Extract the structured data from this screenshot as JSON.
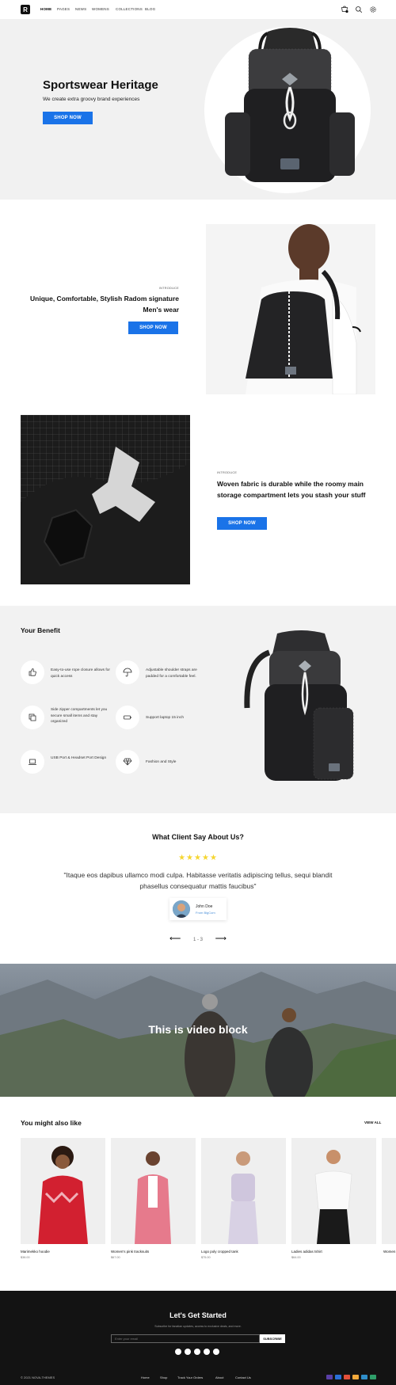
{
  "header": {
    "logo_letter": "R",
    "nav": [
      "HOME",
      "PAGES",
      "NEWS",
      "WOMENS",
      "COLLECTIONS",
      "BLOG"
    ]
  },
  "hero": {
    "title": "Sportswear Heritage",
    "subtitle": "We create extra groovy brand experiences",
    "button": "SHOP NOW"
  },
  "intro1": {
    "tag": "INTRODUCE",
    "title": "Unique, Comfortable, Stylish Radom signature Men's wear",
    "button": "SHOP NOW"
  },
  "intro2": {
    "tag": "INTRODUCE",
    "title": "Woven fabric is durable while the roomy main storage compartment lets you stash your stuff",
    "button": "SHOP NOW"
  },
  "benefits": {
    "title": "Your Benefit",
    "items": [
      {
        "icon": "thumbs-up-icon",
        "text": "Easy-to-use rope closure allows for quick access"
      },
      {
        "icon": "umbrella-icon",
        "text": "Adjustable shoulder straps are padded for a comfortable feel."
      },
      {
        "icon": "copy-icon",
        "text": "Side zipper compartments let you secure small items and stay organized"
      },
      {
        "icon": "battery-icon",
        "text": "Support laptop 15 inch"
      },
      {
        "icon": "laptop-icon",
        "text": "USB Port & Headset Port Design"
      },
      {
        "icon": "diamond-icon",
        "text": "Fashion and Style"
      }
    ]
  },
  "testimonial": {
    "title": "What Client Say About Us?",
    "stars": "★★★★★",
    "quote": "\"Itaque eos dapibus ullamco modi culpa. Habitasse veritatis adipiscing tellus, sequi blandit phasellus consequatur mattis faucibus\"",
    "author": "John Doe",
    "author_sub": "From BigCom",
    "pager": "1 - 3",
    "prev": "⟵",
    "next": "⟶"
  },
  "video": {
    "title": "This is video block"
  },
  "products": {
    "title": "You might also like",
    "view_all": "VIEW ALL",
    "items": [
      {
        "name": "Marimekko hoodie",
        "price": "$38.00",
        "color": "#d22030"
      },
      {
        "name": "Women's pink tracksuits",
        "price": "$67.00",
        "color": "#e67a8c"
      },
      {
        "name": "Logo poly cropped tank",
        "price": "$75.00",
        "color": "#cfc6dd"
      },
      {
        "name": "Ladies adidas tshirt",
        "price": "$64.00",
        "color": "#f0f0f0"
      },
      {
        "name": "Women",
        "price": "",
        "color": "#e8e8e8"
      }
    ]
  },
  "footer": {
    "title": "Let's Get Started",
    "subtitle": "Subscribe for fanatian updates, access to exclusive deals, and more.",
    "email_placeholder": "Enter your email",
    "subscribe": "SUBSCRIBE",
    "copyright": "© 2021 NOVA-THEMES",
    "links": [
      "Home",
      "Shop",
      "Track Your Orders",
      "About",
      "Contact Us"
    ],
    "payment_colors": [
      "#5a3fa6",
      "#2a6fd6",
      "#e24f3a",
      "#f2a93b",
      "#2f8ec9",
      "#2f9e6a"
    ]
  }
}
